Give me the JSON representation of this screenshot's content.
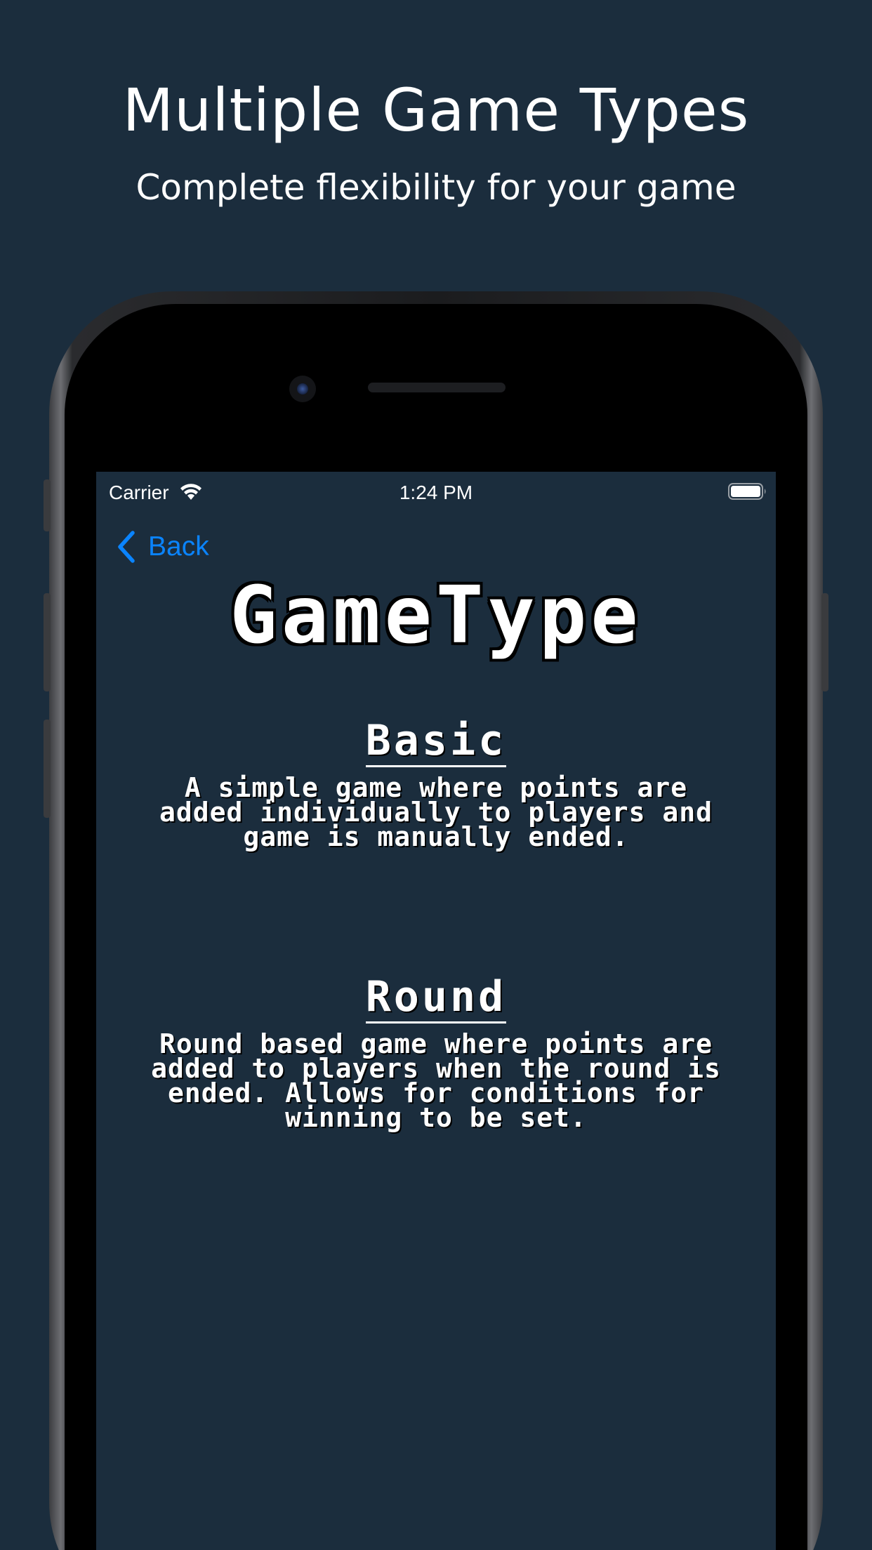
{
  "promo": {
    "headline": "Multiple Game Types",
    "subheadline": "Complete flexibility for your game"
  },
  "status_bar": {
    "carrier": "Carrier",
    "time": "1:24 PM",
    "wifi_icon": "wifi-icon",
    "battery_icon": "battery-icon"
  },
  "nav": {
    "back_label": "Back",
    "back_icon": "chevron-left-icon"
  },
  "screen": {
    "title": "GameType"
  },
  "game_types": [
    {
      "name": "Basic",
      "description": "A simple game where points are added individually to players and game is manually ended."
    },
    {
      "name": "Round",
      "description": "Round based game where points are added to players when the round is ended. Allows for conditions for winning to be set."
    }
  ],
  "colors": {
    "background": "#1b2d3d",
    "accent": "#0a84ff",
    "text": "#ffffff"
  }
}
